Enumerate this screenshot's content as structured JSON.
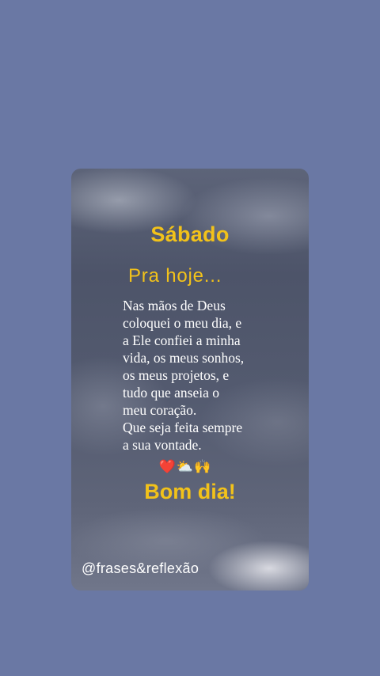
{
  "story": {
    "title": "Sábado",
    "subtitle": "Pra hoje...",
    "body_lines": [
      "Nas mãos de Deus",
      "coloquei o meu dia, e",
      "a Ele confiei a minha",
      "vida, os meus sonhos,",
      "os meus projetos, e",
      "tudo que anseia o",
      "meu coração.",
      "Que seja feita sempre",
      "a sua vontade."
    ],
    "emojis": "❤️⛅🙌",
    "greeting": "Bom dia!",
    "handle": "@frases&reflexão"
  },
  "colors": {
    "background": "#6a78a4",
    "accent_yellow": "#f2c21a",
    "text_white": "#ffffff"
  }
}
